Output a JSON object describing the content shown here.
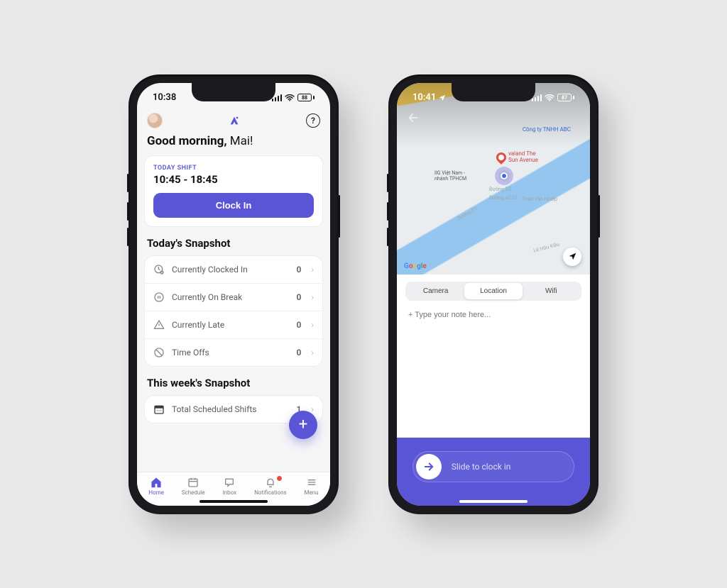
{
  "phone1": {
    "status": {
      "time": "10:38",
      "battery": "88"
    },
    "greeting_bold": "Good morning,",
    "greeting_name": " Mai!",
    "shift": {
      "label": "TODAY SHIFT",
      "time": "10:45 - 18:45",
      "button": "Clock In"
    },
    "today_title": "Today's Snapshot",
    "today_rows": [
      {
        "label": "Currently Clocked In",
        "value": "0"
      },
      {
        "label": "Currently On Break",
        "value": "0"
      },
      {
        "label": "Currently Late",
        "value": "0"
      },
      {
        "label": "Time Offs",
        "value": "0"
      }
    ],
    "week_title": "This week's Snapshot",
    "week_row": {
      "label": "Total Scheduled Shifts",
      "value": "1"
    },
    "tabs": {
      "home": "Home",
      "schedule": "Schedule",
      "inbox": "Inbox",
      "notifications": "Notifications",
      "menu": "Menu"
    }
  },
  "phone2": {
    "status": {
      "time": "10:41",
      "battery": "87"
    },
    "map": {
      "poi1": "valand The\nSun Avenue",
      "poi2": "Công ty TNHH ABC",
      "poi3": "IIG Việt Nam -\nnhánh TPHCM",
      "street1": "Đường D2",
      "street2": "Đường số 52",
      "street3": "Đường D1",
      "street4": "Thân Văn Nhiếp",
      "street5": "Lê Hữu Kiều"
    },
    "segments": {
      "camera": "Camera",
      "location": "Location",
      "wifi": "Wifi"
    },
    "note_placeholder": "+ Type your note here...",
    "slider_text": "Slide to clock in"
  }
}
